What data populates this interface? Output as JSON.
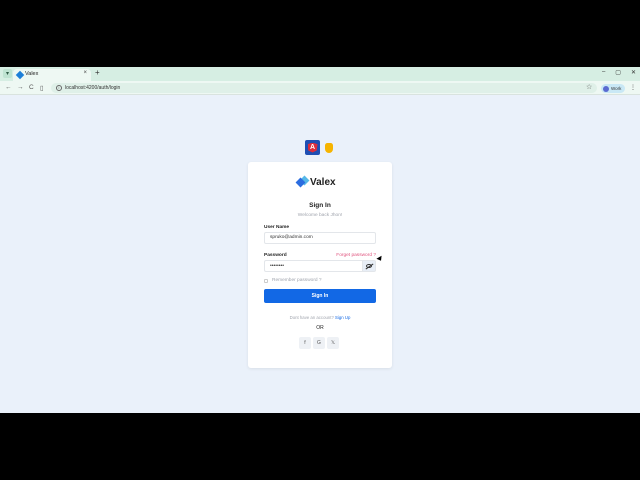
{
  "browser": {
    "tab_title": "Valex",
    "tab_close": "×",
    "new_tab": "+",
    "url": "localhost:4200/auth/login",
    "profile_label": "Work",
    "window_controls": [
      "–",
      "▢",
      "✕"
    ],
    "nav": {
      "back": "←",
      "forward": "→",
      "reload": "C",
      "split": "▯"
    },
    "star": "☆",
    "menu": "⋮"
  },
  "page": {
    "framework_badge_letter": "A",
    "logo_text": "Valex",
    "title": "Sign In",
    "subtitle": "Welcome back Jhon!",
    "username": {
      "label": "User Name",
      "value": "spruko@admin.com"
    },
    "password": {
      "label": "Password",
      "value": "••••••••",
      "forgot_label": "Forget password ?"
    },
    "remember_label": "Remember password ?",
    "signin_button": "Sign In",
    "signup_prompt": "Dont have an account?",
    "signup_link": "Sign Up",
    "or_label": "OR",
    "social": [
      "f",
      "G",
      "𝕏"
    ]
  },
  "colors": {
    "primary": "#1268e5",
    "link_pink": "#e0557f",
    "page_bg": "#eaf1fa"
  }
}
